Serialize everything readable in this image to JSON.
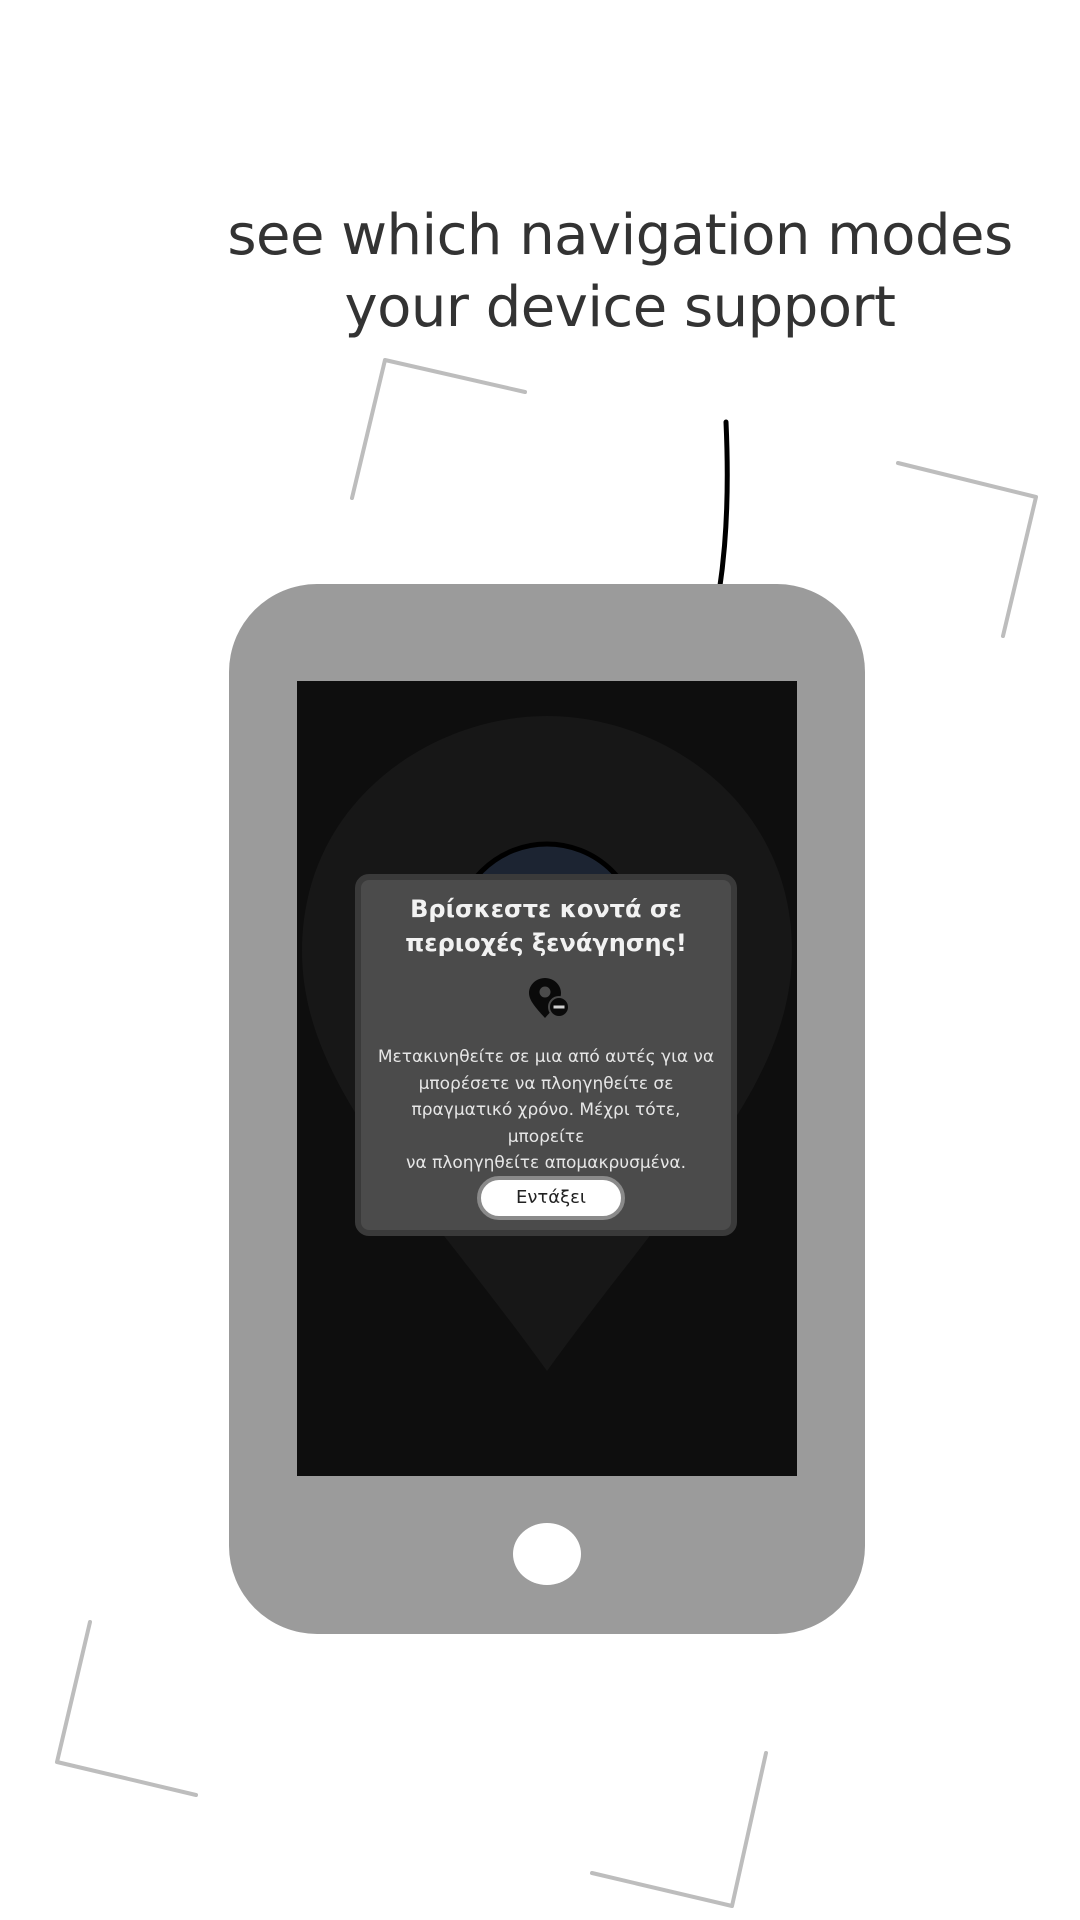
{
  "headline": {
    "line1": "see which navigation modes",
    "line2": "your device support"
  },
  "dialog": {
    "title_line1": "Βρίσκεστε κοντά σε",
    "title_line2": "περιοχές ξενάγησης!",
    "icon": "map-pin-remove-icon",
    "message_lines": [
      "Μετακινηθείτε σε μια από αυτές για να",
      "μπορέσετε να πλοηγηθείτε σε",
      "πραγματικό χρόνο. Μέχρι τότε, μπορείτε",
      "να πλοηγηθείτε απομακρυσμένα."
    ],
    "ok_label": "Εντάξει"
  },
  "colors": {
    "phone_body": "#9b9b9b",
    "screen": "#0e0e0e",
    "dialog_bg": "#4b4b4b",
    "headline_text": "#333333",
    "decor_lines": "#bdbdbd"
  }
}
